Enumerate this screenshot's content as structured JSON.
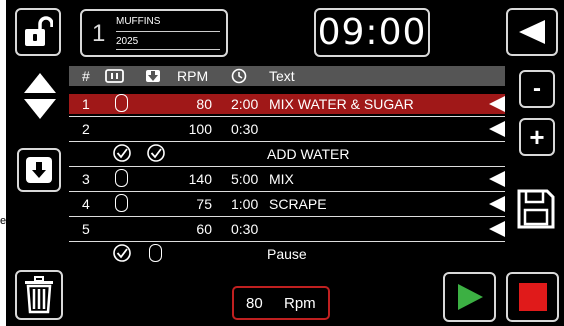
{
  "header": {
    "recipe_number": "1",
    "recipe_name": "MUFFINS",
    "recipe_year": "2025",
    "clock": "09:00"
  },
  "table": {
    "headers": {
      "num": "#",
      "rpm": "RPM",
      "text": "Text"
    },
    "rows": [
      {
        "num": "1",
        "rpm": "80",
        "time": "2:00",
        "text": "MIX WATER & SUGAR",
        "selected": true
      },
      {
        "num": "2",
        "rpm": "100",
        "time": "0:30",
        "text": "",
        "selected": false
      },
      {
        "num": "",
        "rpm": "",
        "time": "",
        "text": "ADD WATER",
        "selected": false
      },
      {
        "num": "3",
        "rpm": "140",
        "time": "5:00",
        "text": "MIX",
        "selected": false
      },
      {
        "num": "4",
        "rpm": "75",
        "time": "1:00",
        "text": "SCRAPE",
        "selected": false
      },
      {
        "num": "5",
        "rpm": "60",
        "time": "0:30",
        "text": "",
        "selected": false
      },
      {
        "num": "",
        "rpm": "",
        "time": "",
        "text": "Pause",
        "selected": false
      }
    ]
  },
  "footer": {
    "rpm_value": "80",
    "rpm_unit": "Rpm"
  },
  "side_labels": {
    "minus": "-",
    "plus": "+"
  },
  "page_fragment": "e",
  "colors": {
    "selected_row": "#a01818",
    "header_bar": "#555555",
    "play": "#3cb043",
    "stop": "#e01a1a",
    "rpm_border": "#c02020"
  }
}
